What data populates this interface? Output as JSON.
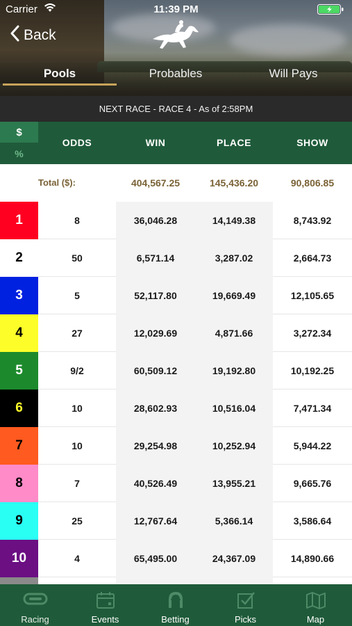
{
  "status": {
    "carrier": "Carrier",
    "time": "11:39 PM"
  },
  "nav": {
    "back_label": "Back"
  },
  "tabs": [
    {
      "label": "Pools",
      "active": true
    },
    {
      "label": "Probables",
      "active": false
    },
    {
      "label": "Will Pays",
      "active": false
    }
  ],
  "race_banner": "NEXT RACE - RACE 4 - As of 2:58PM",
  "toggle": {
    "dollar": "$",
    "percent": "%"
  },
  "columns": [
    "ODDS",
    "WIN",
    "PLACE",
    "SHOW"
  ],
  "totals": {
    "label": "Total ($):",
    "win": "404,567.25",
    "place": "145,436.20",
    "show": "90,806.85"
  },
  "entries": [
    {
      "num": "1",
      "bg": "#ff0021",
      "fg": "#ffffff",
      "odds": "8",
      "win": "36,046.28",
      "place": "14,149.38",
      "show": "8,743.92"
    },
    {
      "num": "2",
      "bg": "#ffffff",
      "fg": "#000000",
      "odds": "50",
      "win": "6,571.14",
      "place": "3,287.02",
      "show": "2,664.73"
    },
    {
      "num": "3",
      "bg": "#0021e0",
      "fg": "#ffffff",
      "odds": "5",
      "win": "52,117.80",
      "place": "19,669.49",
      "show": "12,105.65"
    },
    {
      "num": "4",
      "bg": "#fdfd2a",
      "fg": "#000000",
      "odds": "27",
      "win": "12,029.69",
      "place": "4,871.66",
      "show": "3,272.34"
    },
    {
      "num": "5",
      "bg": "#1c8a2c",
      "fg": "#ffffff",
      "odds": "9/2",
      "win": "60,509.12",
      "place": "19,192.80",
      "show": "10,192.25"
    },
    {
      "num": "6",
      "bg": "#000000",
      "fg": "#fdfd2a",
      "odds": "10",
      "win": "28,602.93",
      "place": "10,516.04",
      "show": "7,471.34"
    },
    {
      "num": "7",
      "bg": "#ff5a1f",
      "fg": "#000000",
      "odds": "10",
      "win": "29,254.98",
      "place": "10,252.94",
      "show": "5,944.22"
    },
    {
      "num": "8",
      "bg": "#ff8bc8",
      "fg": "#000000",
      "odds": "7",
      "win": "40,526.49",
      "place": "13,955.21",
      "show": "9,665.76"
    },
    {
      "num": "9",
      "bg": "#2afff4",
      "fg": "#000000",
      "odds": "25",
      "win": "12,767.64",
      "place": "5,366.14",
      "show": "3,586.64"
    },
    {
      "num": "10",
      "bg": "#6b0f83",
      "fg": "#ffffff",
      "odds": "4",
      "win": "65,495.00",
      "place": "24,367.09",
      "show": "14,890.66"
    }
  ],
  "tabbar": [
    {
      "label": "Racing",
      "icon": "racetrack-icon"
    },
    {
      "label": "Events",
      "icon": "calendar-icon"
    },
    {
      "label": "Betting",
      "icon": "horseshoe-icon"
    },
    {
      "label": "Picks",
      "icon": "checkbox-icon"
    },
    {
      "label": "Map",
      "icon": "map-icon"
    }
  ],
  "colors": {
    "brand_green": "#1f5b3a",
    "accent_gold": "#c8a45a",
    "totals_text": "#7a6236"
  }
}
